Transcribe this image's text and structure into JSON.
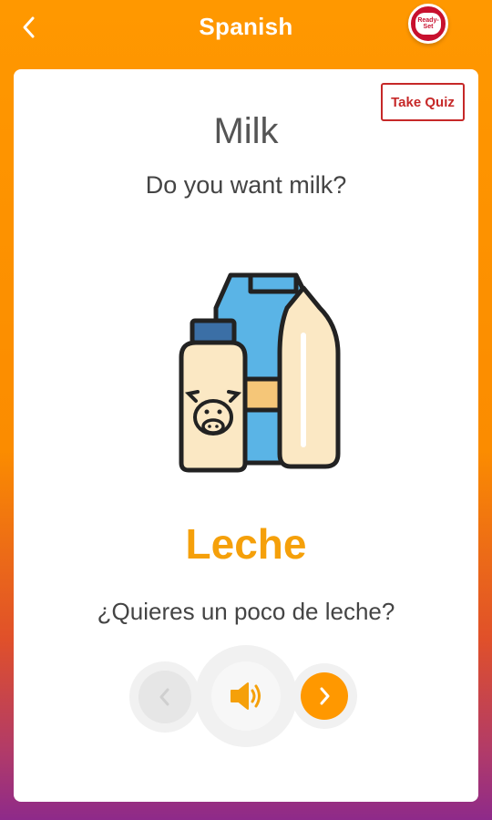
{
  "header": {
    "title": "Spanish",
    "logo_text_line1": "Ready-",
    "logo_text_line2": "Set"
  },
  "card": {
    "take_quiz_label": "Take Quiz",
    "word_english": "Milk",
    "sentence_english": "Do you want milk?",
    "word_spanish": "Leche",
    "sentence_spanish": "¿Quieres un poco de leche?"
  },
  "controls": {
    "prev_icon": "chevron-left-icon",
    "audio_icon": "speaker-icon",
    "next_icon": "chevron-right-icon"
  },
  "colors": {
    "accent_orange": "#ff9800",
    "spanish_word": "#f5a00a",
    "quiz_red": "#c62828"
  }
}
